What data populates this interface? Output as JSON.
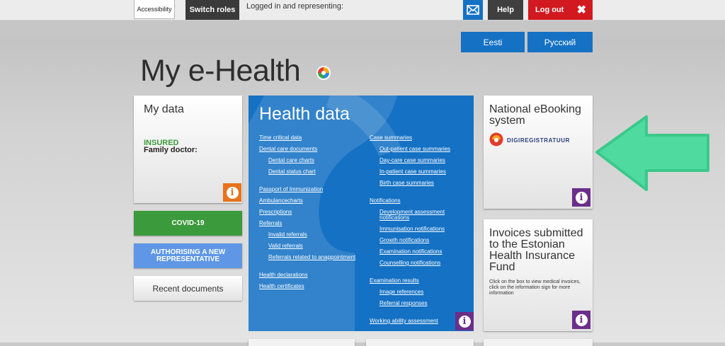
{
  "topbar": {
    "accessibility": "Accessibility",
    "switch_roles": "Switch roles",
    "logged_in_text": "Logged in and representing:",
    "help": "Help",
    "logout": "Log out",
    "logout_icon": "✖"
  },
  "languages": [
    "Eesti",
    "Русский"
  ],
  "page_title": "My e-Health",
  "my_data": {
    "title": "My data",
    "status": "INSURED",
    "family_doctor_label": "Family doctor:",
    "info": "i"
  },
  "side_buttons": {
    "covid": "COVID-19",
    "authorising": "AUTHORISING A NEW REPRESENTATIVE",
    "recent": "Recent documents"
  },
  "health_data": {
    "title": "Health data",
    "info": "i",
    "left_links": [
      "Time critical data",
      "Dental care documents",
      "Dental care charts",
      "Dental status chart",
      "Passport of Immunization",
      "Ambulancecharts",
      "Prescriptions",
      "Referrals",
      "Invalid referrals",
      "Valid referrals",
      "Referrals related to anappointment",
      "Health declarations",
      "Health certificates"
    ],
    "right_links": [
      "Case summaries",
      "Out-patient case summaries",
      "Day-care case summaries",
      "In-patient case summaries",
      "Birth case summaries",
      "Notifications",
      "Development assessment notifications",
      "Immunisation notifications",
      "Growth notifications",
      "Examination notifications",
      "Counselling notifications",
      "Examination results",
      "Image references",
      "Referral responses",
      "Working ability assessment"
    ]
  },
  "ebooking": {
    "title": "National eBooking system",
    "logo_text": "DIGIREGISTRATUUR",
    "info": "i"
  },
  "invoices": {
    "title": "Invoices submitted to the Estonian Health Insurance Fund",
    "description": "Click on the box to view medical invoices, click on the information sign for more information",
    "info": "i"
  },
  "colors": {
    "brand_blue": "#1471c4",
    "covid_green": "#3b9a3b",
    "authorise_blue": "#5f97e6",
    "logout_red": "#d2191f",
    "info_orange": "#e9721b",
    "info_purple": "#6b2e8a",
    "arrow_green": "#4fdba0"
  },
  "icons": {
    "mail": "mail-icon",
    "logo": "e-health-logo-icon",
    "info": "info-icon",
    "arrow": "left-arrow-icon"
  }
}
